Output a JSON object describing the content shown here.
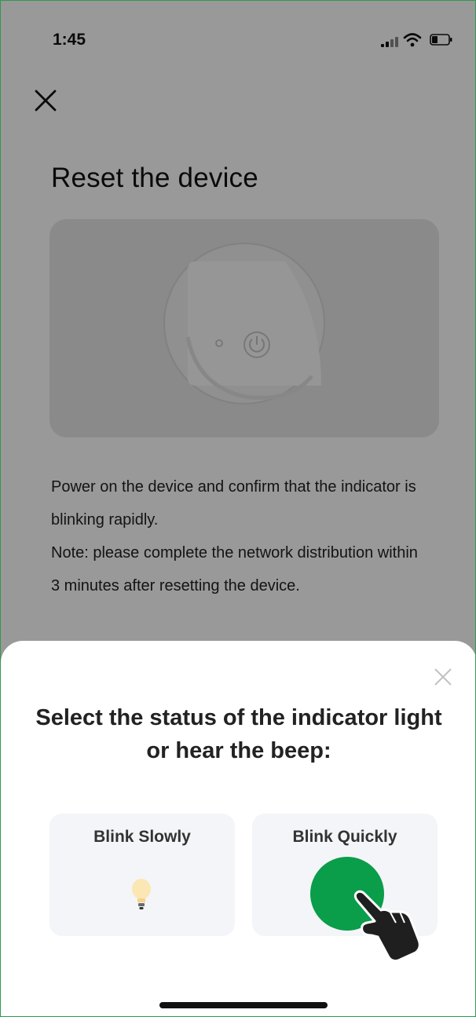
{
  "status_bar": {
    "time": "1:45"
  },
  "page": {
    "title": "Reset the device",
    "description_lines": [
      "Power on the device and confirm that the indicator is blinking rapidly.",
      "Note: please complete the network distribution within 3 minutes after resetting the device."
    ]
  },
  "sheet": {
    "title": "Select the status of the indicator light or hear the beep:",
    "options": [
      {
        "label": "Blink Slowly",
        "icon": "lightbulb-icon"
      },
      {
        "label": "Blink Quickly",
        "icon": "green-indicator"
      }
    ]
  },
  "colors": {
    "accent_green": "#0a9d4a",
    "overlay": "rgba(0,0,0,0.40)",
    "frame_border": "#2e9a4e"
  }
}
